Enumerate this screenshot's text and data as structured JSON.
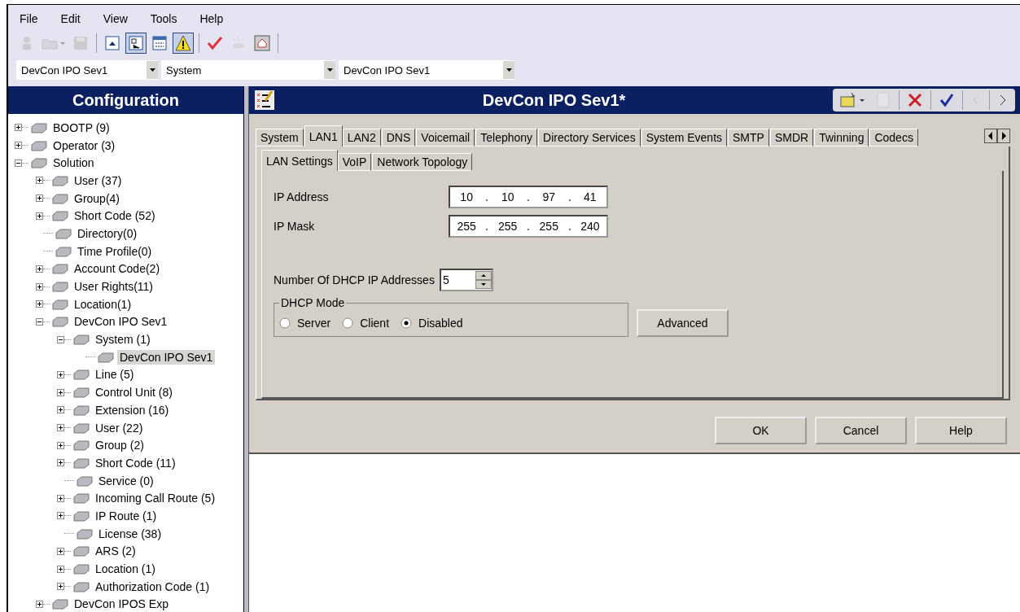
{
  "menu": [
    "File",
    "Edit",
    "View",
    "Tools",
    "Help"
  ],
  "toolbar": [
    {
      "kind": "user",
      "pressed": false,
      "disabled": true
    },
    {
      "kind": "open",
      "pressed": false,
      "disabled": true
    },
    {
      "kind": "save",
      "pressed": false,
      "disabled": true
    },
    {
      "kind": "up",
      "pressed": false,
      "disabled": false
    },
    {
      "kind": "tree",
      "pressed": true,
      "disabled": false
    },
    {
      "kind": "list",
      "pressed": false,
      "disabled": false
    },
    {
      "kind": "warning",
      "pressed": true,
      "disabled": false
    },
    {
      "kind": "check",
      "pressed": false,
      "disabled": false
    },
    {
      "kind": "bell",
      "pressed": false,
      "disabled": true
    },
    {
      "kind": "home",
      "pressed": false,
      "disabled": false
    }
  ],
  "selectors": [
    {
      "value": "DevCon IPO Sev1"
    },
    {
      "value": "System"
    },
    {
      "value": "DevCon IPO Sev1"
    }
  ],
  "navigator": {
    "title": "Configuration",
    "tree": [
      {
        "label": "BOOTP (9)",
        "expanded": false,
        "selected": false
      },
      {
        "label": "Operator (3)",
        "expanded": false,
        "selected": false
      },
      {
        "label": "Solution",
        "expanded": true,
        "selected": false,
        "children": [
          {
            "label": "User (37)",
            "expanded": false,
            "selected": false
          },
          {
            "label": "Group(4)",
            "expanded": false,
            "selected": false
          },
          {
            "label": "Short Code (52)",
            "expanded": false,
            "selected": false
          },
          {
            "label": "Directory(0)",
            "selected": false
          },
          {
            "label": "Time Profile(0)",
            "selected": false
          },
          {
            "label": "Account Code(2)",
            "expanded": false,
            "selected": false
          },
          {
            "label": "User Rights(11)",
            "expanded": false,
            "selected": false
          },
          {
            "label": "Location(1)",
            "expanded": false,
            "selected": false
          },
          {
            "label": "DevCon IPO Sev1",
            "expanded": true,
            "selected": false,
            "children": [
              {
                "label": "System (1)",
                "expanded": true,
                "selected": false,
                "children": [
                  {
                    "label": "DevCon IPO Sev1",
                    "selected": true
                  }
                ]
              },
              {
                "label": "Line (5)",
                "expanded": false,
                "selected": false
              },
              {
                "label": "Control Unit (8)",
                "expanded": false,
                "selected": false
              },
              {
                "label": "Extension (16)",
                "expanded": false,
                "selected": false
              },
              {
                "label": "User (22)",
                "expanded": false,
                "selected": false
              },
              {
                "label": "Group (2)",
                "expanded": false,
                "selected": false
              },
              {
                "label": "Short Code (11)",
                "expanded": false,
                "selected": false
              },
              {
                "label": "Service (0)",
                "selected": false
              },
              {
                "label": "Incoming Call Route (5)",
                "expanded": false,
                "selected": false
              },
              {
                "label": "IP Route (1)",
                "expanded": false,
                "selected": false
              },
              {
                "label": "License (38)",
                "selected": false
              },
              {
                "label": "ARS (2)",
                "expanded": false,
                "selected": false
              },
              {
                "label": "Location (1)",
                "expanded": false,
                "selected": false
              },
              {
                "label": "Authorization Code (1)",
                "expanded": false,
                "selected": false
              }
            ]
          },
          {
            "label": "DevCon IPOS Exp",
            "expanded": false,
            "selected": false
          }
        ]
      }
    ]
  },
  "editor": {
    "title": "DevCon IPO Sev1*",
    "actions": [
      {
        "kind": "new",
        "disabled": false
      },
      {
        "kind": "doc",
        "disabled": true
      },
      {
        "kind": "delete",
        "disabled": false
      },
      {
        "kind": "validate",
        "disabled": false
      },
      {
        "kind": "prev",
        "disabled": true
      },
      {
        "kind": "next",
        "disabled": false
      }
    ],
    "tabs": [
      {
        "label": "System",
        "selected": false
      },
      {
        "label": "LAN1",
        "selected": true
      },
      {
        "label": "LAN2",
        "selected": false
      },
      {
        "label": "DNS",
        "selected": false
      },
      {
        "label": "Voicemail",
        "selected": false
      },
      {
        "label": "Telephony",
        "selected": false
      },
      {
        "label": "Directory Services",
        "selected": false
      },
      {
        "label": "System Events",
        "selected": false
      },
      {
        "label": "SMTP",
        "selected": false
      },
      {
        "label": "SMDR",
        "selected": false
      },
      {
        "label": "Twinning",
        "selected": false
      },
      {
        "label": "Codecs",
        "selected": false
      }
    ],
    "subtabs": [
      {
        "label": "LAN Settings",
        "selected": true
      },
      {
        "label": "VoIP",
        "selected": false
      },
      {
        "label": "Network Topology",
        "selected": false
      }
    ],
    "ip_address": {
      "label": "IP Address",
      "octets": [
        "10",
        "10",
        "97",
        "41"
      ]
    },
    "ip_mask": {
      "label": "IP Mask",
      "octets": [
        "255",
        "255",
        "255",
        "240"
      ]
    },
    "dhcp_count": {
      "label": "Number Of DHCP IP Addresses",
      "value": "5"
    },
    "dhcp_mode": {
      "title": "DHCP Mode",
      "options": [
        {
          "label": "Server",
          "selected": false
        },
        {
          "label": "Client",
          "selected": false
        },
        {
          "label": "Disabled",
          "selected": true
        }
      ]
    },
    "advanced_button": "Advanced",
    "buttons": [
      "OK",
      "Cancel",
      "Help"
    ]
  }
}
